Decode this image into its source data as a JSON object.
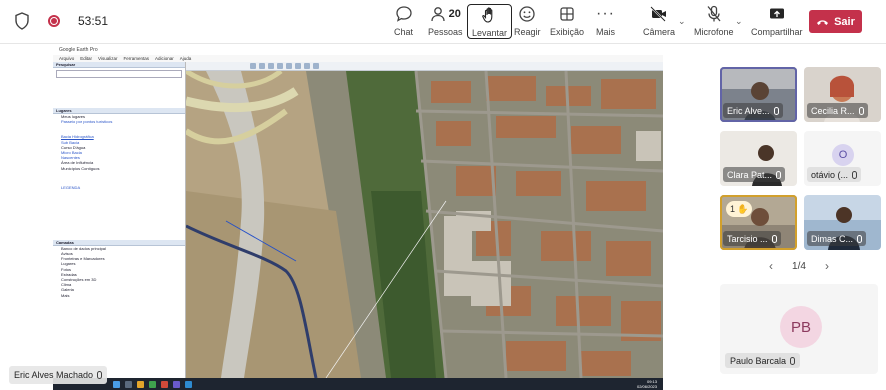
{
  "meeting": {
    "timer": "53:51",
    "people_count": "20"
  },
  "toolbar": {
    "chat_label": "Chat",
    "people_label": "Pessoas",
    "raise_label": "Levantar",
    "react_label": "Reagir",
    "view_label": "Exibição",
    "more_label": "Mais",
    "camera_label": "Câmera",
    "mic_label": "Microfone",
    "share_label": "Compartilhar",
    "leave_label": "Sair"
  },
  "presenter": {
    "name": "Eric Alves Machado"
  },
  "shared_screen": {
    "app_title": "Google Earth Pro",
    "menu": [
      "Arquivo",
      "Editar",
      "Visualizar",
      "Ferramentas",
      "Adicionar",
      "Ajuda"
    ],
    "search_section": "Pesquisar",
    "places_section": "Lugares",
    "layers_section": "Camadas",
    "places_items": [
      "Meus lugares",
      "Passeio por pontos turísticos",
      "Bacia Hidrográfica",
      "Sub Bacia",
      "Curso D'água",
      "Micro Bacia",
      "Nascentes",
      "Área de Influência",
      "Municípios Contíguos",
      "LEGENDA"
    ],
    "layers_items": [
      "Banco de dados principal",
      "Avisos",
      "Fronteiras e Marcadores",
      "Lugares",
      "Fotos",
      "Estradas",
      "Construções em 3D",
      "Clima",
      "Galeria",
      "Mais"
    ],
    "taskbar_time": "09:13",
    "taskbar_date": "02/06/2023"
  },
  "participants": [
    {
      "name": "Eric Alves Machado",
      "short": "Eric Alve...",
      "active": true
    },
    {
      "name": "Cecilia R",
      "short": "Cecilia R..."
    },
    {
      "name": "Clara Pat",
      "short": "Clara Pat..."
    },
    {
      "name": "otávio",
      "short": "otávio (...",
      "initial": "O"
    },
    {
      "name": "Tarcisio",
      "short": "Tarcisio ...",
      "hand_count": "1"
    },
    {
      "name": "Dimas C",
      "short": "Dimas C..."
    }
  ],
  "pager": {
    "text": "1/4"
  },
  "spotlight": {
    "name": "Paulo Barcala",
    "initials": "PB"
  },
  "colors": {
    "leave": "#c4314b",
    "active_ring": "#6264a7",
    "raised_ring": "#d2a02c"
  }
}
